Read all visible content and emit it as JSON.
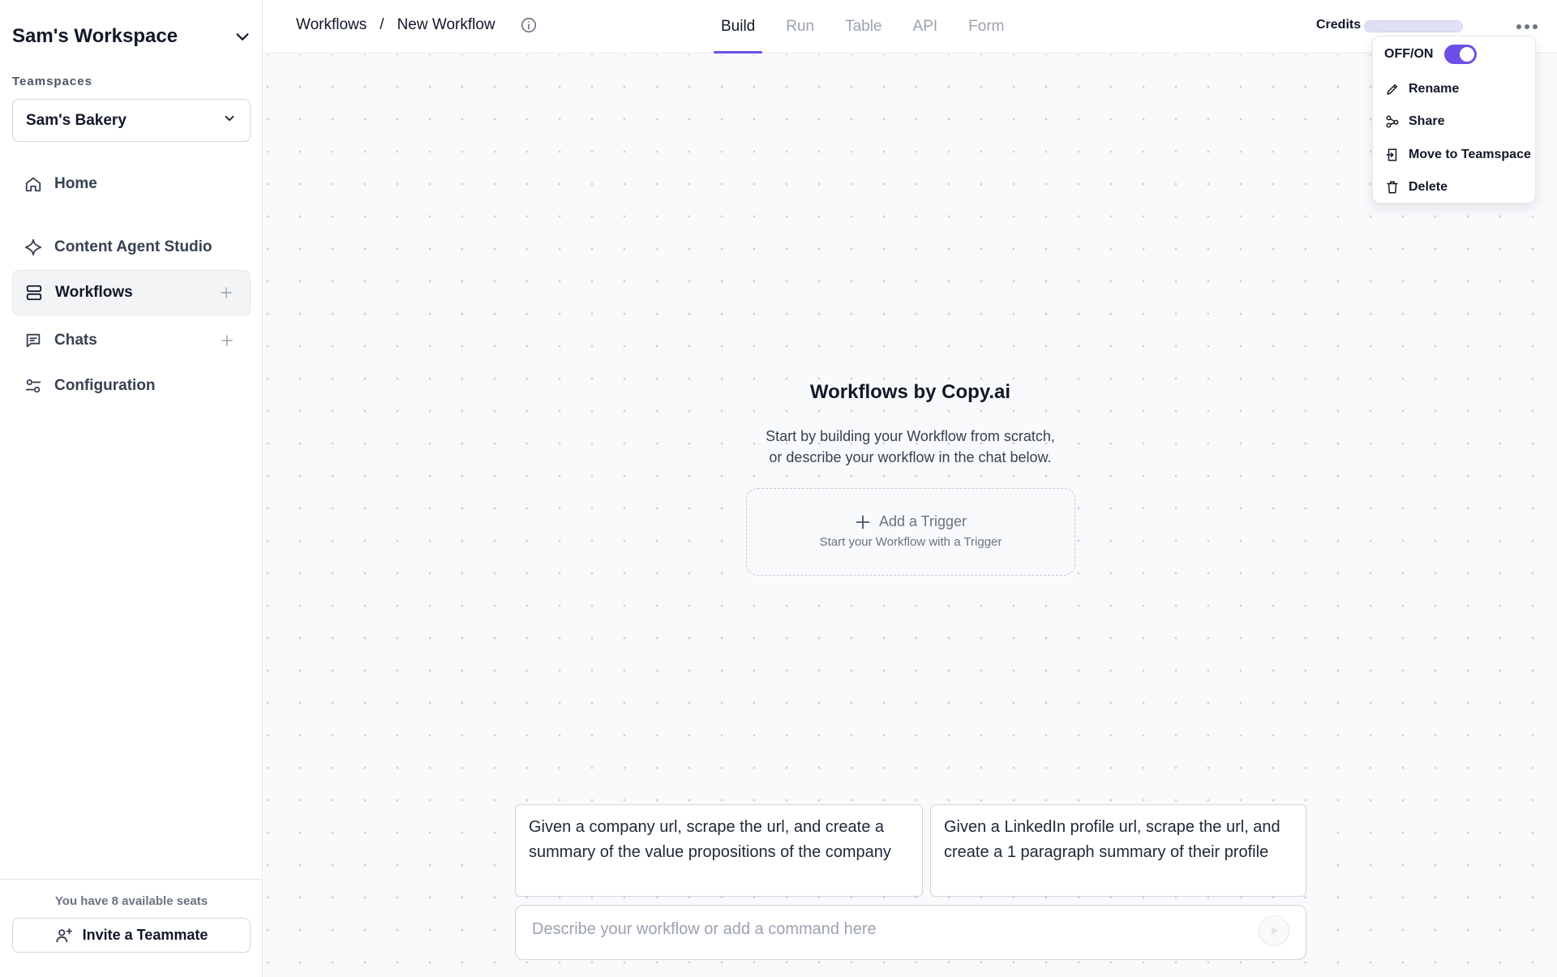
{
  "sidebar": {
    "workspace_title": "Sam's Workspace",
    "teamspaces_label": "Teamspaces",
    "teamspace_selected": "Sam's Bakery",
    "items": [
      {
        "label": "Home",
        "icon": "home-icon"
      },
      {
        "label": "Content Agent Studio",
        "icon": "sparkle-icon"
      },
      {
        "label": "Workflows",
        "icon": "workflow-icon"
      },
      {
        "label": "Chats",
        "icon": "chat-icon"
      },
      {
        "label": "Configuration",
        "icon": "sliders-icon"
      }
    ],
    "seats_text": "You have 8 available seats",
    "invite_label": "Invite a Teammate"
  },
  "header": {
    "breadcrumb": [
      "Workflows",
      "New Workflow"
    ],
    "breadcrumb_separator": "/",
    "tabs": [
      {
        "label": "Build",
        "active": true
      },
      {
        "label": "Run",
        "active": false
      },
      {
        "label": "Table",
        "active": false
      },
      {
        "label": "API",
        "active": false
      },
      {
        "label": "Form",
        "active": false
      }
    ],
    "credits_label": "Credits"
  },
  "menu": {
    "toggle_label": "OFF/ON",
    "toggle_on": true,
    "items": [
      {
        "label": "Rename",
        "icon": "pencil-icon"
      },
      {
        "label": "Share",
        "icon": "share-icon"
      },
      {
        "label": "Move to Teamspace",
        "icon": "move-icon"
      },
      {
        "label": "Delete",
        "icon": "trash-icon"
      }
    ]
  },
  "main": {
    "title": "Workflows by Copy.ai",
    "subtitle_line1": "Start by building your Workflow from scratch,",
    "subtitle_line2": "or describe your workflow in the chat below.",
    "trigger_label": "Add a Trigger",
    "trigger_sub": "Start your Workflow with a Trigger",
    "suggestions": [
      "Given a company url, scrape the url, and create a summary of the value propositions of the company",
      "Given a LinkedIn profile url, scrape the url, and create a 1 paragraph summary of their profile"
    ],
    "prompt_placeholder": "Describe your workflow or add a command here",
    "prompt_value": ""
  },
  "colors": {
    "accent": "#6d4fe6",
    "canvas_bg": "#f9fafc",
    "credit_bar": "#e0e0f4"
  }
}
